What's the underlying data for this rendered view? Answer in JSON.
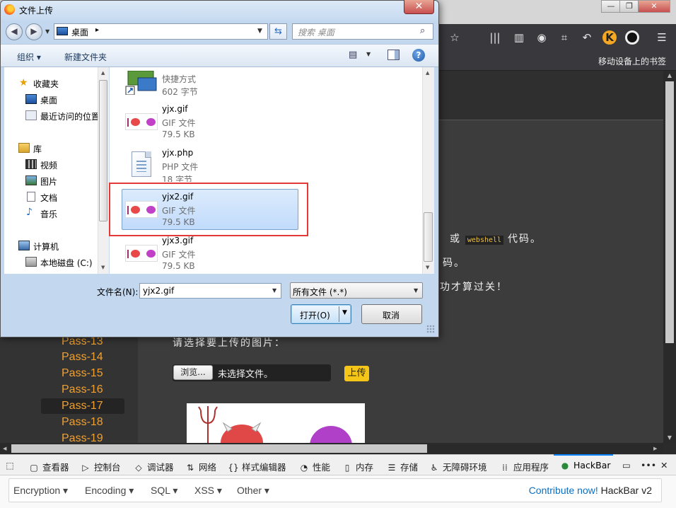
{
  "dialog": {
    "title": "文件上传",
    "address": "桌面",
    "search_placeholder": "搜索 桌面",
    "organize": "组织 ▾",
    "new_folder": "新建文件夹",
    "nav": {
      "favorites": "收藏夹",
      "desktop": "桌面",
      "recent": "最近访问的位置",
      "libraries": "库",
      "videos": "视频",
      "pictures": "图片",
      "documents": "文档",
      "music": "音乐",
      "computer": "计算机",
      "local_disk": "本地磁盘 (C:)"
    },
    "files": [
      {
        "name": "",
        "type": "快捷方式",
        "size": "602 字节"
      },
      {
        "name": "yjx.gif",
        "type": "GIF 文件",
        "size": "79.5 KB"
      },
      {
        "name": "yjx.php",
        "type": "PHP 文件",
        "size": "18 字节"
      },
      {
        "name": "yjx2.gif",
        "type": "GIF 文件",
        "size": "79.5 KB"
      },
      {
        "name": "yjx3.gif",
        "type": "GIF 文件",
        "size": "79.5 KB"
      }
    ],
    "filename_label": "文件名(N):",
    "filename_value": "yjx2.gif",
    "filetype_value": "所有文件 (*.*)",
    "open_label": "打开(O)",
    "cancel_label": "取消"
  },
  "browser": {
    "mobile_bookmarks": "移动设备上的书签",
    "passes": [
      "Pass-13",
      "Pass-14",
      "Pass-15",
      "Pass-16",
      "Pass-17",
      "Pass-18",
      "Pass-19"
    ],
    "active_pass": "Pass-17",
    "content": {
      "line1_end": "或",
      "line1_code": "webshell",
      "line1_tail": "代码。",
      "line2_end": "码。",
      "line3_end": "功才算过关！",
      "prompt": "请选择要上传的图片：",
      "browse_label": "浏览...",
      "no_file": "未选择文件。",
      "upload_label": "上传"
    }
  },
  "devtools": {
    "tabs": [
      "查看器",
      "控制台",
      "调试器",
      "网络",
      "样式编辑器",
      "性能",
      "内存",
      "存储",
      "无障碍环境",
      "应用程序",
      "HackBar"
    ],
    "active_tab": "HackBar",
    "hackbar_menus": [
      "Encryption ▾",
      "Encoding ▾",
      "SQL ▾",
      "XSS ▾",
      "Other ▾"
    ],
    "contribute": "Contribute now!",
    "hackbar_version": "HackBar v2"
  },
  "colors": {
    "pass_link": "#f0a030",
    "selection": "#c1dbfc",
    "highlight_box": "#e53935",
    "upload_button": "#f5c518",
    "devtools_active": "#0a84ff"
  }
}
